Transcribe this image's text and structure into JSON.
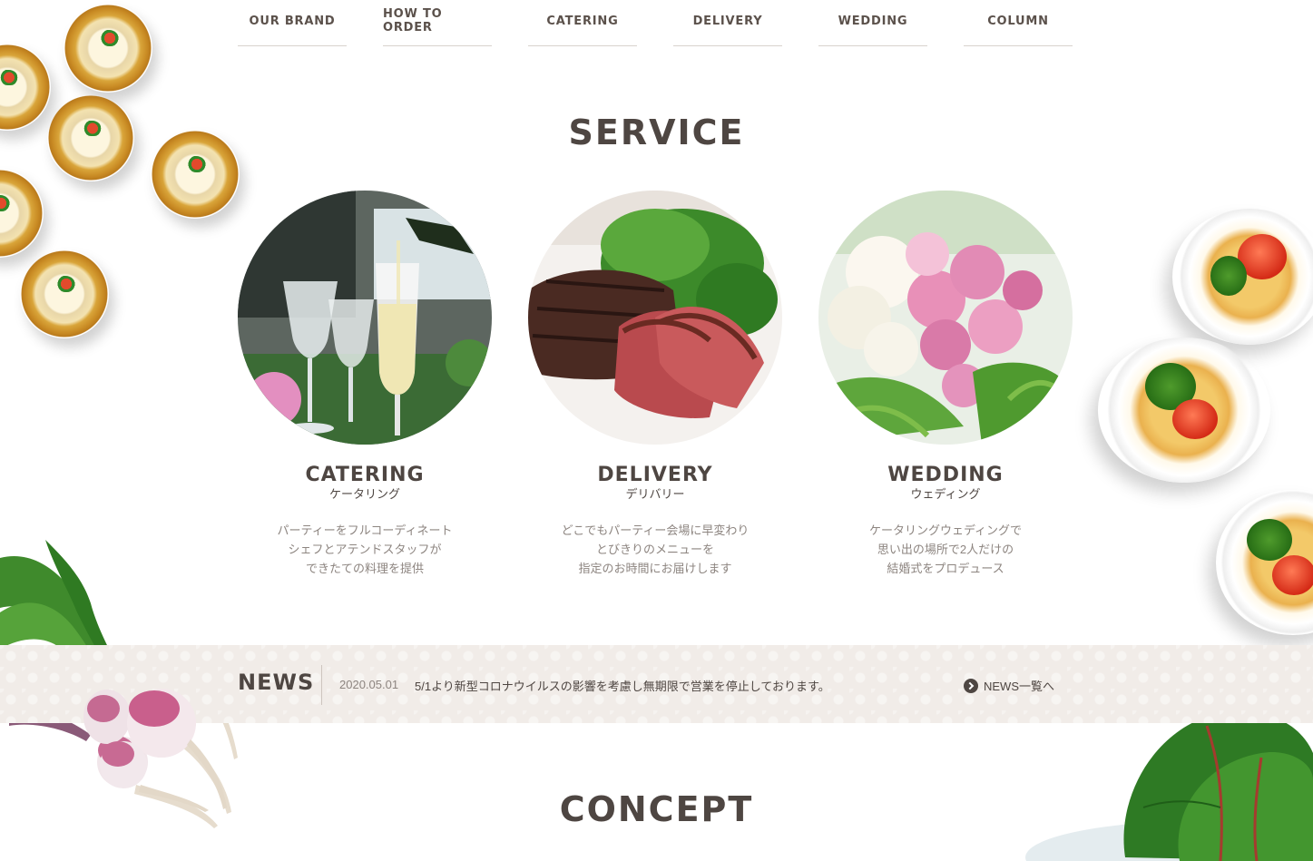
{
  "nav": {
    "items": [
      {
        "label": "OUR BRAND"
      },
      {
        "label": "HOW TO ORDER"
      },
      {
        "label": "CATERING"
      },
      {
        "label": "DELIVERY"
      },
      {
        "label": "WEDDING"
      },
      {
        "label": "COLUMN"
      }
    ]
  },
  "service": {
    "title": "SERVICE",
    "cards": [
      {
        "title": "CATERING",
        "subtitle": "ケータリング",
        "lines": [
          "パーティーをフルコーディネート",
          "シェフとアテンドスタッフが",
          "できたての料理を提供"
        ]
      },
      {
        "title": "DELIVERY",
        "subtitle": "デリバリー",
        "lines": [
          "どこでもパーティー会場に早変わり",
          "とびきりのメニューを",
          "指定のお時間にお届けします"
        ]
      },
      {
        "title": "WEDDING",
        "subtitle": "ウェディング",
        "lines": [
          "ケータリングウェディングで",
          "思い出の場所で2人だけの",
          "結婚式をプロデュース"
        ]
      }
    ]
  },
  "news": {
    "label": "NEWS",
    "date": "2020.05.01",
    "text": "5/1より新型コロナウイルスの影響を考慮し無期限で営業を停止しております。",
    "link_label": "NEWS一覧へ"
  },
  "concept": {
    "title": "CONCEPT"
  },
  "icons": {
    "news_link": "chevron-right-circle-icon"
  },
  "colors": {
    "text": "#4e4642",
    "muted": "#8d8580",
    "news_bg": "#f1ece8"
  }
}
